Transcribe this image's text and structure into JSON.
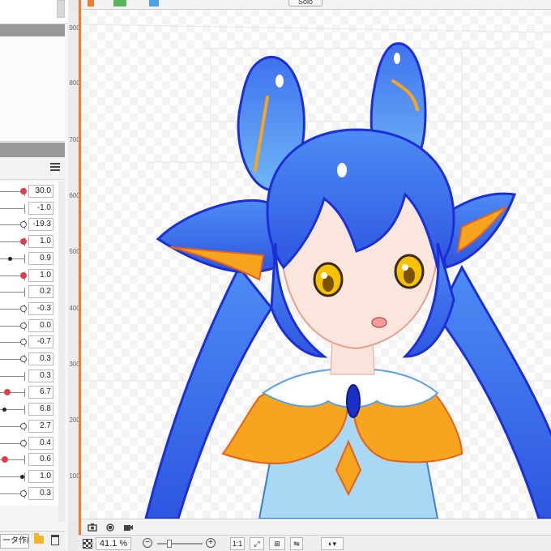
{
  "parameters": {
    "menu_icon": "hamburger-menu-icon",
    "rows": [
      {
        "value": "30.0",
        "knob": "red"
      },
      {
        "value": "-1.0",
        "knob": "none"
      },
      {
        "value": "-19.3",
        "knob": "white"
      },
      {
        "value": "1.0",
        "knob": "red"
      },
      {
        "value": "0.9",
        "knob": "dot"
      },
      {
        "value": "1.0",
        "knob": "red"
      },
      {
        "value": "0.2",
        "knob": "none"
      },
      {
        "value": "-0.3",
        "knob": "white"
      },
      {
        "value": "0.0",
        "knob": "white"
      },
      {
        "value": "-0.7",
        "knob": "white"
      },
      {
        "value": "0.3",
        "knob": "white"
      },
      {
        "value": "0.3",
        "knob": "none"
      },
      {
        "value": "6.7",
        "knob": "red"
      },
      {
        "value": "6.8",
        "knob": "dot"
      },
      {
        "value": "2.7",
        "knob": "white"
      },
      {
        "value": "0.4",
        "knob": "white"
      },
      {
        "value": "0.6",
        "knob": "red"
      },
      {
        "value": "1.0",
        "knob": "dot"
      },
      {
        "value": "0.3",
        "knob": "white"
      }
    ]
  },
  "left_bottom": {
    "create_label": "ータ作成",
    "folder_icon": "folder-icon",
    "trash_icon": "trash-icon"
  },
  "canvas_toolbar": {
    "solo_label": "Solo"
  },
  "ruler": {
    "labels": [
      "900",
      "800",
      "700",
      "600",
      "500",
      "400",
      "300",
      "200",
      "100"
    ]
  },
  "canvas_bottom": {
    "camera_icon": "camera-icon",
    "camera_reset_icon": "camera-reset-icon",
    "video_icon": "video-camera-icon"
  },
  "status_bar": {
    "zoom_value": "41.1",
    "zoom_unit": "%",
    "ratio_label": "1:1"
  },
  "colors": {
    "accent": "#f07a2d",
    "hair": "#3d6fe6",
    "outfit_orange": "#f7a51e",
    "knob_red": "#e0404e"
  }
}
